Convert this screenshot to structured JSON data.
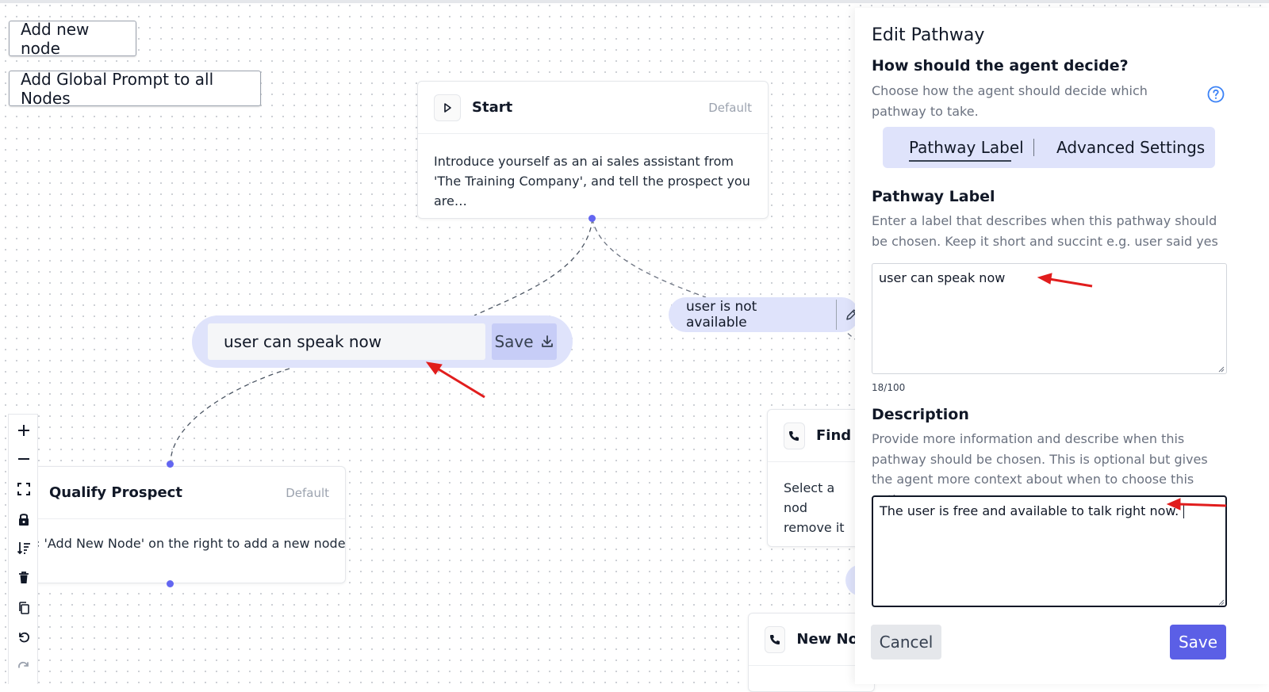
{
  "canvas": {
    "add_node_label": "Add new node",
    "add_global_prompt_label": "Add Global Prompt to all Nodes"
  },
  "nodes": {
    "start": {
      "title": "Start",
      "tag": "Default",
      "body": "Introduce yourself as an ai sales assistant from 'The Training Company', and tell the prospect you are…"
    },
    "qualify": {
      "title": "Qualify Prospect",
      "tag": "Default",
      "body": "‹ 'Add New Node' on the right to add a new node"
    },
    "find": {
      "title": "Find /",
      "body": "Select a nod remove it"
    },
    "new_node": {
      "title": "New No"
    }
  },
  "edges": {
    "editing_label_value": "user can speak now",
    "save_label": "Save",
    "other_label": "user is not available"
  },
  "toolbar": {
    "icons": [
      "plus-icon",
      "minus-icon",
      "fit-view-icon",
      "lock-icon",
      "sort-icon",
      "trash-icon",
      "copy-icon",
      "undo-icon",
      "redo-icon"
    ]
  },
  "panel": {
    "title": "Edit Pathway",
    "question": "How should the agent decide?",
    "question_help": "Choose how the agent should decide which pathway to take.",
    "tabs": [
      "Pathway Label",
      "Advanced Settings"
    ],
    "active_tab": "Pathway Label",
    "label_heading": "Pathway Label",
    "label_help": "Enter a label that describes when this pathway should be chosen. Keep it short and succint e.g. user said yes",
    "label_value": "user can speak now",
    "label_counter": "18/100",
    "description_heading": "Description",
    "description_help": "Provide more information and describe when this pathway should be chosen. This is optional but gives the agent more context about when to choose this pathway.",
    "description_value": "The user is free and available to talk right now.",
    "cancel_label": "Cancel",
    "save_label": "Save"
  },
  "colors": {
    "accent": "#5b5fe6",
    "pill_bg": "#dfe3fb",
    "annotation_arrow": "#e11d1d"
  }
}
